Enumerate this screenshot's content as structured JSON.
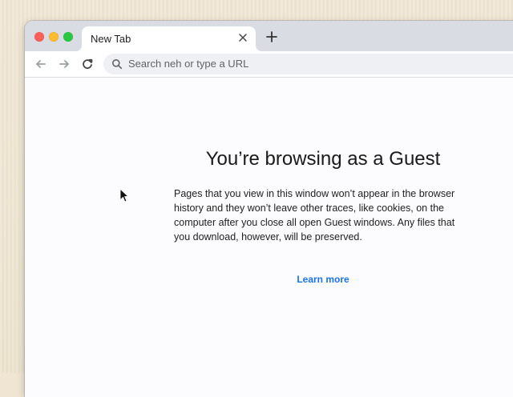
{
  "browser": {
    "tab": {
      "title": "New Tab"
    },
    "toolbar": {
      "omnibox_placeholder": "Search neh or type a URL"
    }
  },
  "content": {
    "heading": "You’re browsing as a Guest",
    "body": "Pages that you view in this window won’t appear in the browser history and they won’t leave other traces, like cookies, on the computer after you close all open Guest windows. Any files that you download, however, will be preserved.",
    "link": "Learn more"
  },
  "icons": {
    "close": "close-icon",
    "plus": "plus-icon",
    "back": "back-arrow-icon",
    "forward": "forward-arrow-icon",
    "reload": "reload-icon",
    "search": "search-icon",
    "cursor": "mouse-cursor-icon"
  },
  "colors": {
    "link": "#1a73e8",
    "window_close": "#ff5f57",
    "window_minimize": "#febc2e",
    "window_zoom": "#28c840"
  }
}
